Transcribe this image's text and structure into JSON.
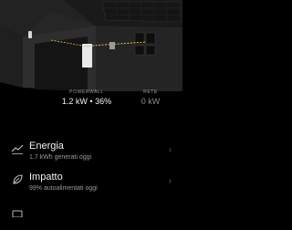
{
  "powerwall": {
    "label": "POWERWALL",
    "value": "1.2 kW • 36%"
  },
  "grid": {
    "label": "RETE",
    "value": "0 kW"
  },
  "menu": [
    {
      "title": "Energia",
      "subtitle": "1.7 kWh generati oggi",
      "icon": "chart-line-icon"
    },
    {
      "title": "Impatto",
      "subtitle": "99% autoalimentati oggi",
      "icon": "leaf-icon"
    },
    {
      "title": "",
      "subtitle": "",
      "icon": "partial-icon"
    }
  ],
  "colors": {
    "accent": "#e6c34a",
    "background": "#000000"
  }
}
